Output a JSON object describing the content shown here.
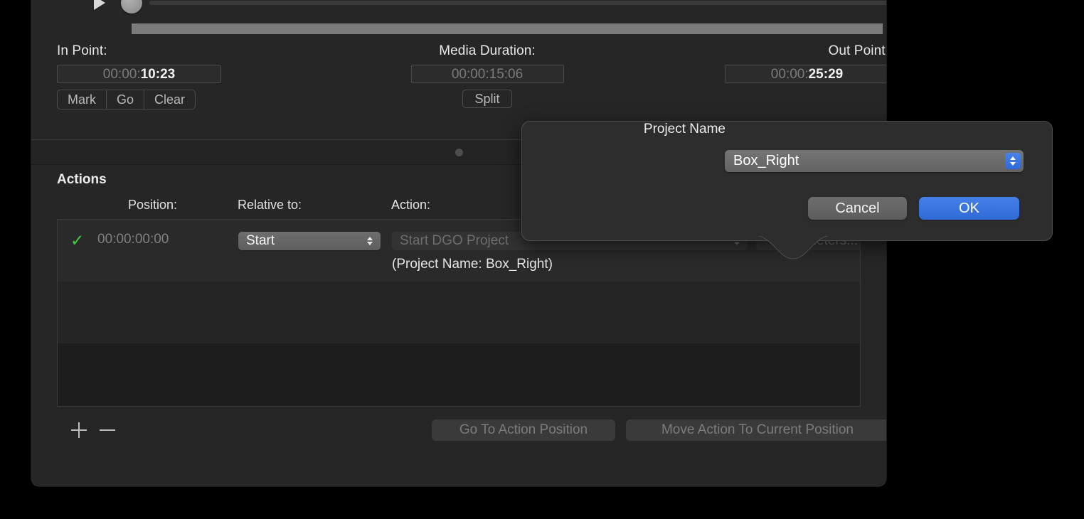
{
  "transport": {
    "play_icon": "play-triangle-icon",
    "scrubber_position": 0
  },
  "points": {
    "in_point": {
      "label": "In Point:",
      "value_dim": "00:00:",
      "value_hl": "10:23",
      "full_value": "00:00:10:23"
    },
    "media_duration": {
      "label": "Media Duration:",
      "value": "00:00:15:06"
    },
    "out_point": {
      "label": "Out Point:",
      "value_dim": "00:00:",
      "value_hl": "25:29",
      "full_value": "00:00:25:29"
    },
    "segmented": [
      "Mark",
      "Go",
      "Clear"
    ],
    "split_label": "Split"
  },
  "actions": {
    "title": "Actions",
    "columns": [
      "Position:",
      "Relative to:",
      "Action:"
    ],
    "rows": [
      {
        "enabled_check": "✓",
        "position": "00:00:00:00",
        "relative_to": "Start",
        "action": "Start DGO Project",
        "parameters_label": "Parameters...",
        "detail": "(Project Name: Box_Right)"
      }
    ],
    "add_icon": "plus-icon",
    "remove_icon": "minus-icon",
    "go_to_action_position": "Go To Action Position",
    "move_action_to_current_position": "Move Action To Current Position"
  },
  "popover": {
    "field_label": "Project Name",
    "field_value": "Box_Right",
    "cancel_label": "Cancel",
    "ok_label": "OK",
    "accent_color": "#3b74de"
  }
}
